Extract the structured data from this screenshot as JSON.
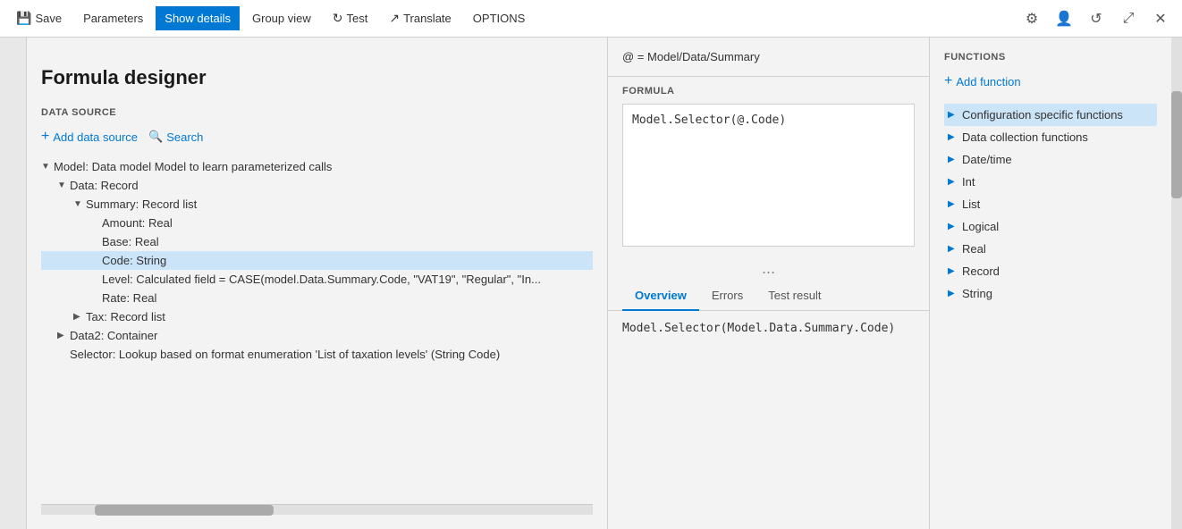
{
  "titlebar": {
    "save_label": "Save",
    "parameters_label": "Parameters",
    "show_details_label": "Show details",
    "group_view_label": "Group view",
    "test_label": "Test",
    "translate_label": "Translate",
    "options_label": "OPTIONS",
    "search_icon": "🔍"
  },
  "datasource": {
    "section_title": "DATA SOURCE",
    "add_label": "Add data source",
    "search_label": "Search",
    "tree": [
      {
        "id": "model",
        "indent": 0,
        "chevron": "▼",
        "label": "Model: Data model Model to learn parameterized calls",
        "selected": false
      },
      {
        "id": "data",
        "indent": 1,
        "chevron": "▼",
        "label": "Data: Record",
        "selected": false
      },
      {
        "id": "summary",
        "indent": 2,
        "chevron": "▼",
        "label": "Summary: Record list",
        "selected": false
      },
      {
        "id": "amount",
        "indent": 3,
        "chevron": "",
        "label": "Amount: Real",
        "selected": false
      },
      {
        "id": "base",
        "indent": 3,
        "chevron": "",
        "label": "Base: Real",
        "selected": false
      },
      {
        "id": "code",
        "indent": 3,
        "chevron": "",
        "label": "Code: String",
        "selected": true
      },
      {
        "id": "level",
        "indent": 3,
        "chevron": "",
        "label": "Level: Calculated field = CASE(model.Data.Summary.Code, \"VAT19\", \"Regular\", \"In...",
        "selected": false
      },
      {
        "id": "rate",
        "indent": 3,
        "chevron": "",
        "label": "Rate: Real",
        "selected": false
      },
      {
        "id": "tax",
        "indent": 2,
        "chevron": "▶",
        "label": "Tax: Record list",
        "selected": false
      },
      {
        "id": "data2",
        "indent": 1,
        "chevron": "▶",
        "label": "Data2: Container",
        "selected": false
      },
      {
        "id": "selector",
        "indent": 1,
        "chevron": "",
        "label": "Selector: Lookup based on format enumeration 'List of taxation levels' (String Code)",
        "selected": false
      }
    ]
  },
  "formula": {
    "path": "@ = Model/Data/Summary",
    "section_title": "FORMULA",
    "expression": "Model.Selector(@.Code)",
    "more": "...",
    "tabs": [
      {
        "id": "overview",
        "label": "Overview",
        "active": true
      },
      {
        "id": "errors",
        "label": "Errors",
        "active": false
      },
      {
        "id": "test_result",
        "label": "Test result",
        "active": false
      }
    ],
    "result": "Model.Selector(Model.Data.Summary.Code)"
  },
  "functions": {
    "section_title": "FUNCTIONS",
    "add_label": "Add function",
    "items": [
      {
        "id": "config",
        "label": "Configuration specific functions",
        "selected": true
      },
      {
        "id": "datacoll",
        "label": "Data collection functions",
        "selected": false
      },
      {
        "id": "datetime",
        "label": "Date/time",
        "selected": false
      },
      {
        "id": "int",
        "label": "Int",
        "selected": false
      },
      {
        "id": "list",
        "label": "List",
        "selected": false
      },
      {
        "id": "logical",
        "label": "Logical",
        "selected": false
      },
      {
        "id": "real",
        "label": "Real",
        "selected": false
      },
      {
        "id": "record",
        "label": "Record",
        "selected": false
      },
      {
        "id": "string",
        "label": "String",
        "selected": false
      }
    ]
  }
}
